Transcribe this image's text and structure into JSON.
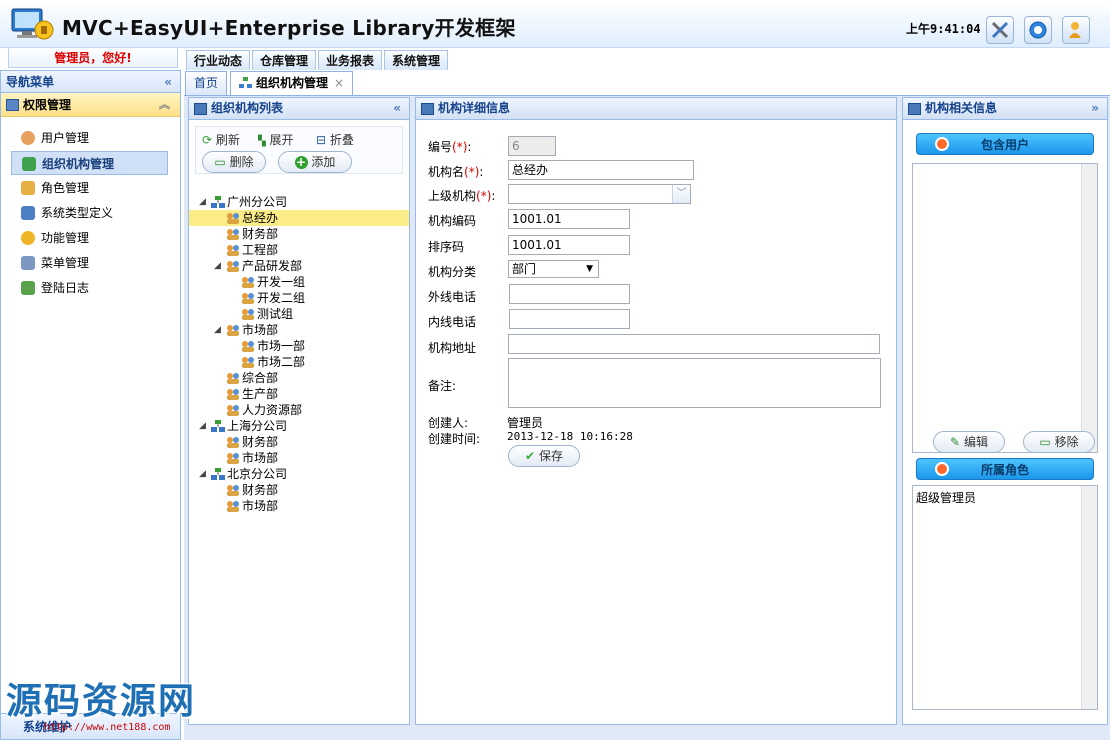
{
  "header": {
    "title": "MVC+EasyUI+Enterprise Library开发框架",
    "time": "上午9:41:04",
    "user_greeting": "管理员，您好!"
  },
  "top_menu": [
    "行业动态",
    "仓库管理",
    "业务报表",
    "系统管理"
  ],
  "nav": {
    "title": "导航菜单",
    "group": "权限管理",
    "items": [
      {
        "label": "用户管理",
        "icon": "user-icon"
      },
      {
        "label": "组织机构管理",
        "icon": "org-icon",
        "selected": true
      },
      {
        "label": "角色管理",
        "icon": "role-icon"
      },
      {
        "label": "系统类型定义",
        "icon": "system-type-icon"
      },
      {
        "label": "功能管理",
        "icon": "key-icon"
      },
      {
        "label": "菜单管理",
        "icon": "tools-icon"
      },
      {
        "label": "登陆日志",
        "icon": "log-icon"
      }
    ],
    "footer": "系统维护"
  },
  "tabs": [
    {
      "label": "首页",
      "active": false
    },
    {
      "label": "组织机构管理",
      "active": true
    }
  ],
  "tree_panel": {
    "title": "组织机构列表",
    "toolbar": {
      "refresh": "刷新",
      "expand": "展开",
      "collapse": "折叠",
      "delete": "删除",
      "add": "添加"
    },
    "nodes": [
      {
        "label": "广州分公司",
        "level": 0,
        "type": "company",
        "expanded": true
      },
      {
        "label": "总经办",
        "level": 1,
        "type": "dept",
        "selected": true
      },
      {
        "label": "财务部",
        "level": 1,
        "type": "dept"
      },
      {
        "label": "工程部",
        "level": 1,
        "type": "dept"
      },
      {
        "label": "产品研发部",
        "level": 1,
        "type": "dept",
        "expanded": true
      },
      {
        "label": "开发一组",
        "level": 2,
        "type": "dept"
      },
      {
        "label": "开发二组",
        "level": 2,
        "type": "dept"
      },
      {
        "label": "测试组",
        "level": 2,
        "type": "dept"
      },
      {
        "label": "市场部",
        "level": 1,
        "type": "dept",
        "expanded": true
      },
      {
        "label": "市场一部",
        "level": 2,
        "type": "dept"
      },
      {
        "label": "市场二部",
        "level": 2,
        "type": "dept"
      },
      {
        "label": "综合部",
        "level": 1,
        "type": "dept"
      },
      {
        "label": "生产部",
        "level": 1,
        "type": "dept"
      },
      {
        "label": "人力资源部",
        "level": 1,
        "type": "dept"
      },
      {
        "label": "上海分公司",
        "level": 0,
        "type": "company",
        "expanded": true
      },
      {
        "label": "财务部",
        "level": 1,
        "type": "dept"
      },
      {
        "label": "市场部",
        "level": 1,
        "type": "dept"
      },
      {
        "label": "北京分公司",
        "level": 0,
        "type": "company",
        "expanded": true
      },
      {
        "label": "财务部",
        "level": 1,
        "type": "dept"
      },
      {
        "label": "市场部",
        "level": 1,
        "type": "dept"
      }
    ]
  },
  "detail_panel": {
    "title": "机构详细信息",
    "labels": {
      "id": "编号",
      "name": "机构名",
      "parent": "上级机构",
      "code": "机构编码",
      "sort": "排序码",
      "category": "机构分类",
      "outer_phone": "外线电话",
      "inner_phone": "内线电话",
      "address": "机构地址",
      "remark": "备注",
      "creator": "创建人:",
      "created_time": "创建时间:"
    },
    "required_mark": "(*)",
    "values": {
      "id": "6",
      "name": "总经办",
      "parent": "",
      "code": "1001.01",
      "sort": "1001.01",
      "category": "部门",
      "outer_phone": "",
      "inner_phone": "",
      "address": "",
      "remark": "",
      "creator": "管理员",
      "created_time": "2013-12-18 10:16:28"
    },
    "save": "保存"
  },
  "related_panel": {
    "title": "机构相关信息",
    "users_button": "包含用户",
    "edit": "编辑",
    "remove": "移除",
    "roles_button": "所属角色",
    "roles": [
      "超级管理员"
    ]
  },
  "watermark": {
    "text": "源码资源网",
    "url": "http://www.net188.com"
  },
  "colors": {
    "accent": "#15428b",
    "border": "#99bbe8",
    "selected_tree": "#fbec88",
    "required": "#dd0000"
  }
}
